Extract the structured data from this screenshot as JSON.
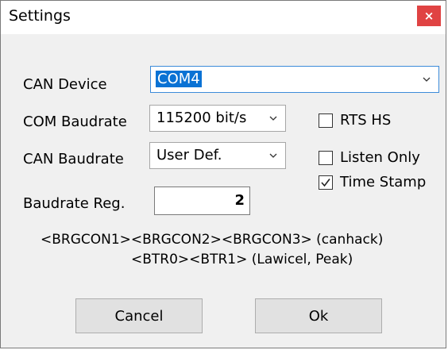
{
  "window": {
    "title": "Settings",
    "close_glyph": "×"
  },
  "form": {
    "can_device_label": "CAN Device",
    "can_device_value": "COM4",
    "com_baudrate_label": "COM Baudrate",
    "com_baudrate_value": "115200 bit/s",
    "can_baudrate_label": "CAN Baudrate",
    "can_baudrate_value": "User Def.",
    "baudrate_reg_label": "Baudrate Reg.",
    "baudrate_reg_value": "2"
  },
  "options": {
    "rts_hs_label": "RTS HS",
    "rts_hs_checked": false,
    "listen_only_label": "Listen Only",
    "listen_only_checked": false,
    "time_stamp_label": "Time Stamp",
    "time_stamp_checked": true
  },
  "hint": {
    "line1": "<BRGCON1><BRGCON2><BRGCON3> (canhack)",
    "line2": "<BTR0><BTR1> (Lawicel, Peak)"
  },
  "buttons": {
    "cancel_label": "Cancel",
    "ok_label": "Ok"
  },
  "colors": {
    "close_button": "#e04343",
    "selection": "#0a72d4",
    "dialog_bg": "#f0f0f0"
  }
}
